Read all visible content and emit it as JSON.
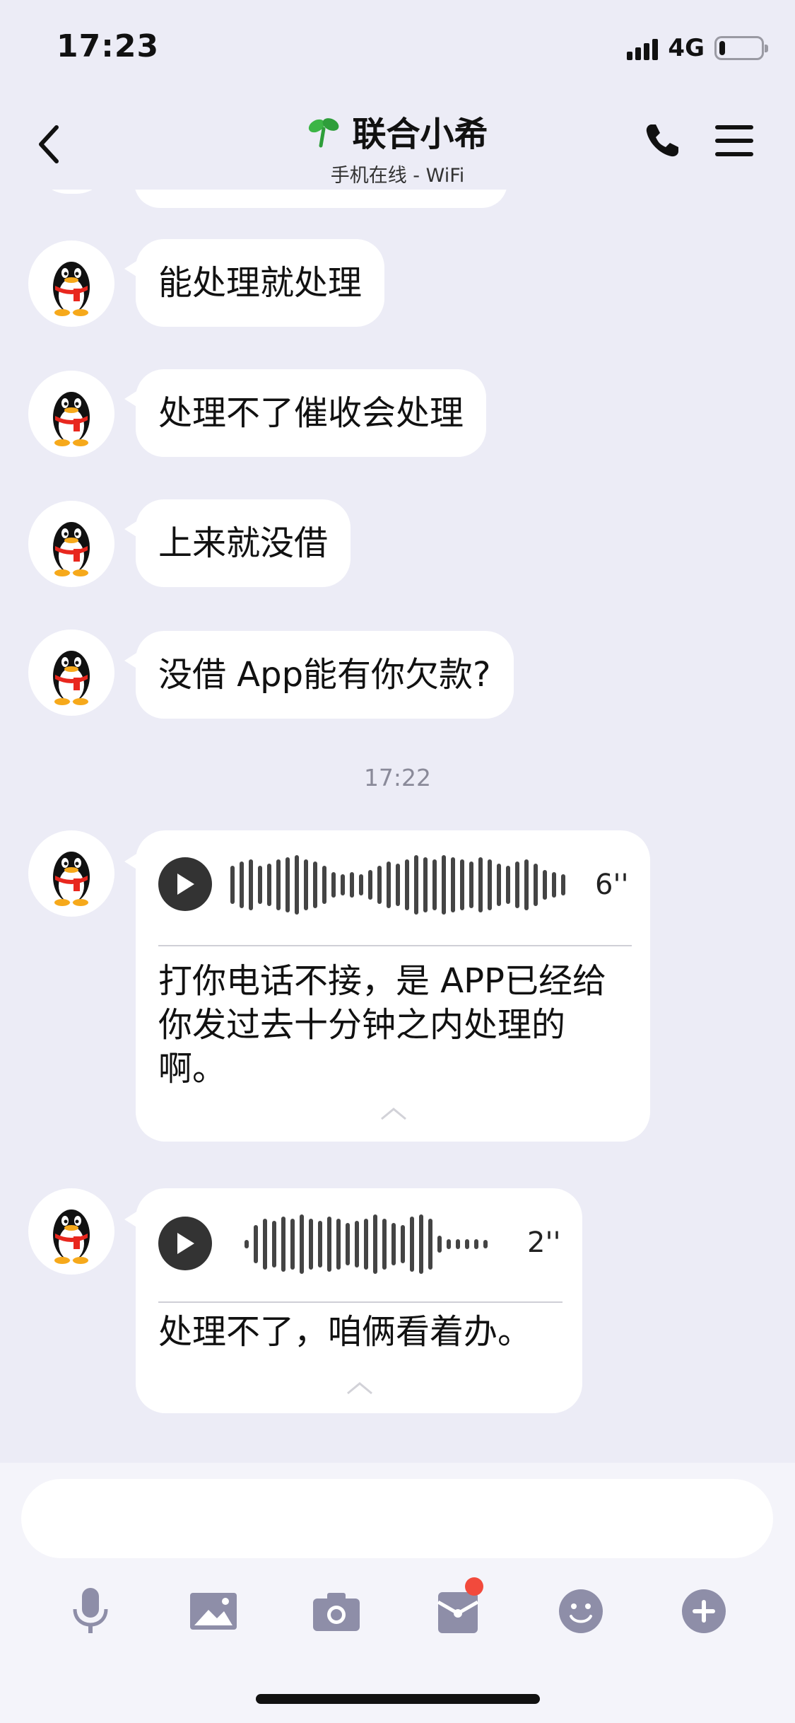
{
  "status_bar": {
    "time": "17:23",
    "network": "4G",
    "battery_level": 0.15
  },
  "header": {
    "title": "联合小希",
    "subtitle": "手机在线 - WiFi"
  },
  "messages": [
    {
      "text": "能处理就处理"
    },
    {
      "text": "处理不了催收会处理"
    },
    {
      "text": "上来就没借"
    },
    {
      "text": "没借 App能有你欠款?"
    }
  ],
  "timestamp": "17:22",
  "voice_messages": [
    {
      "duration": "6''",
      "transcript": "打你电话不接，是 APP已经给你发过去十分钟之内处理的啊。"
    },
    {
      "duration": "2''",
      "transcript": "处理不了，咱俩看着办。"
    }
  ],
  "input": {
    "placeholder": ""
  },
  "toolbar": {
    "icons": [
      "microphone-icon",
      "image-icon",
      "camera-icon",
      "red-packet-icon",
      "emoji-icon",
      "plus-icon"
    ],
    "badge_color": "#f24a3c",
    "icon_color": "#8e8ea8"
  }
}
